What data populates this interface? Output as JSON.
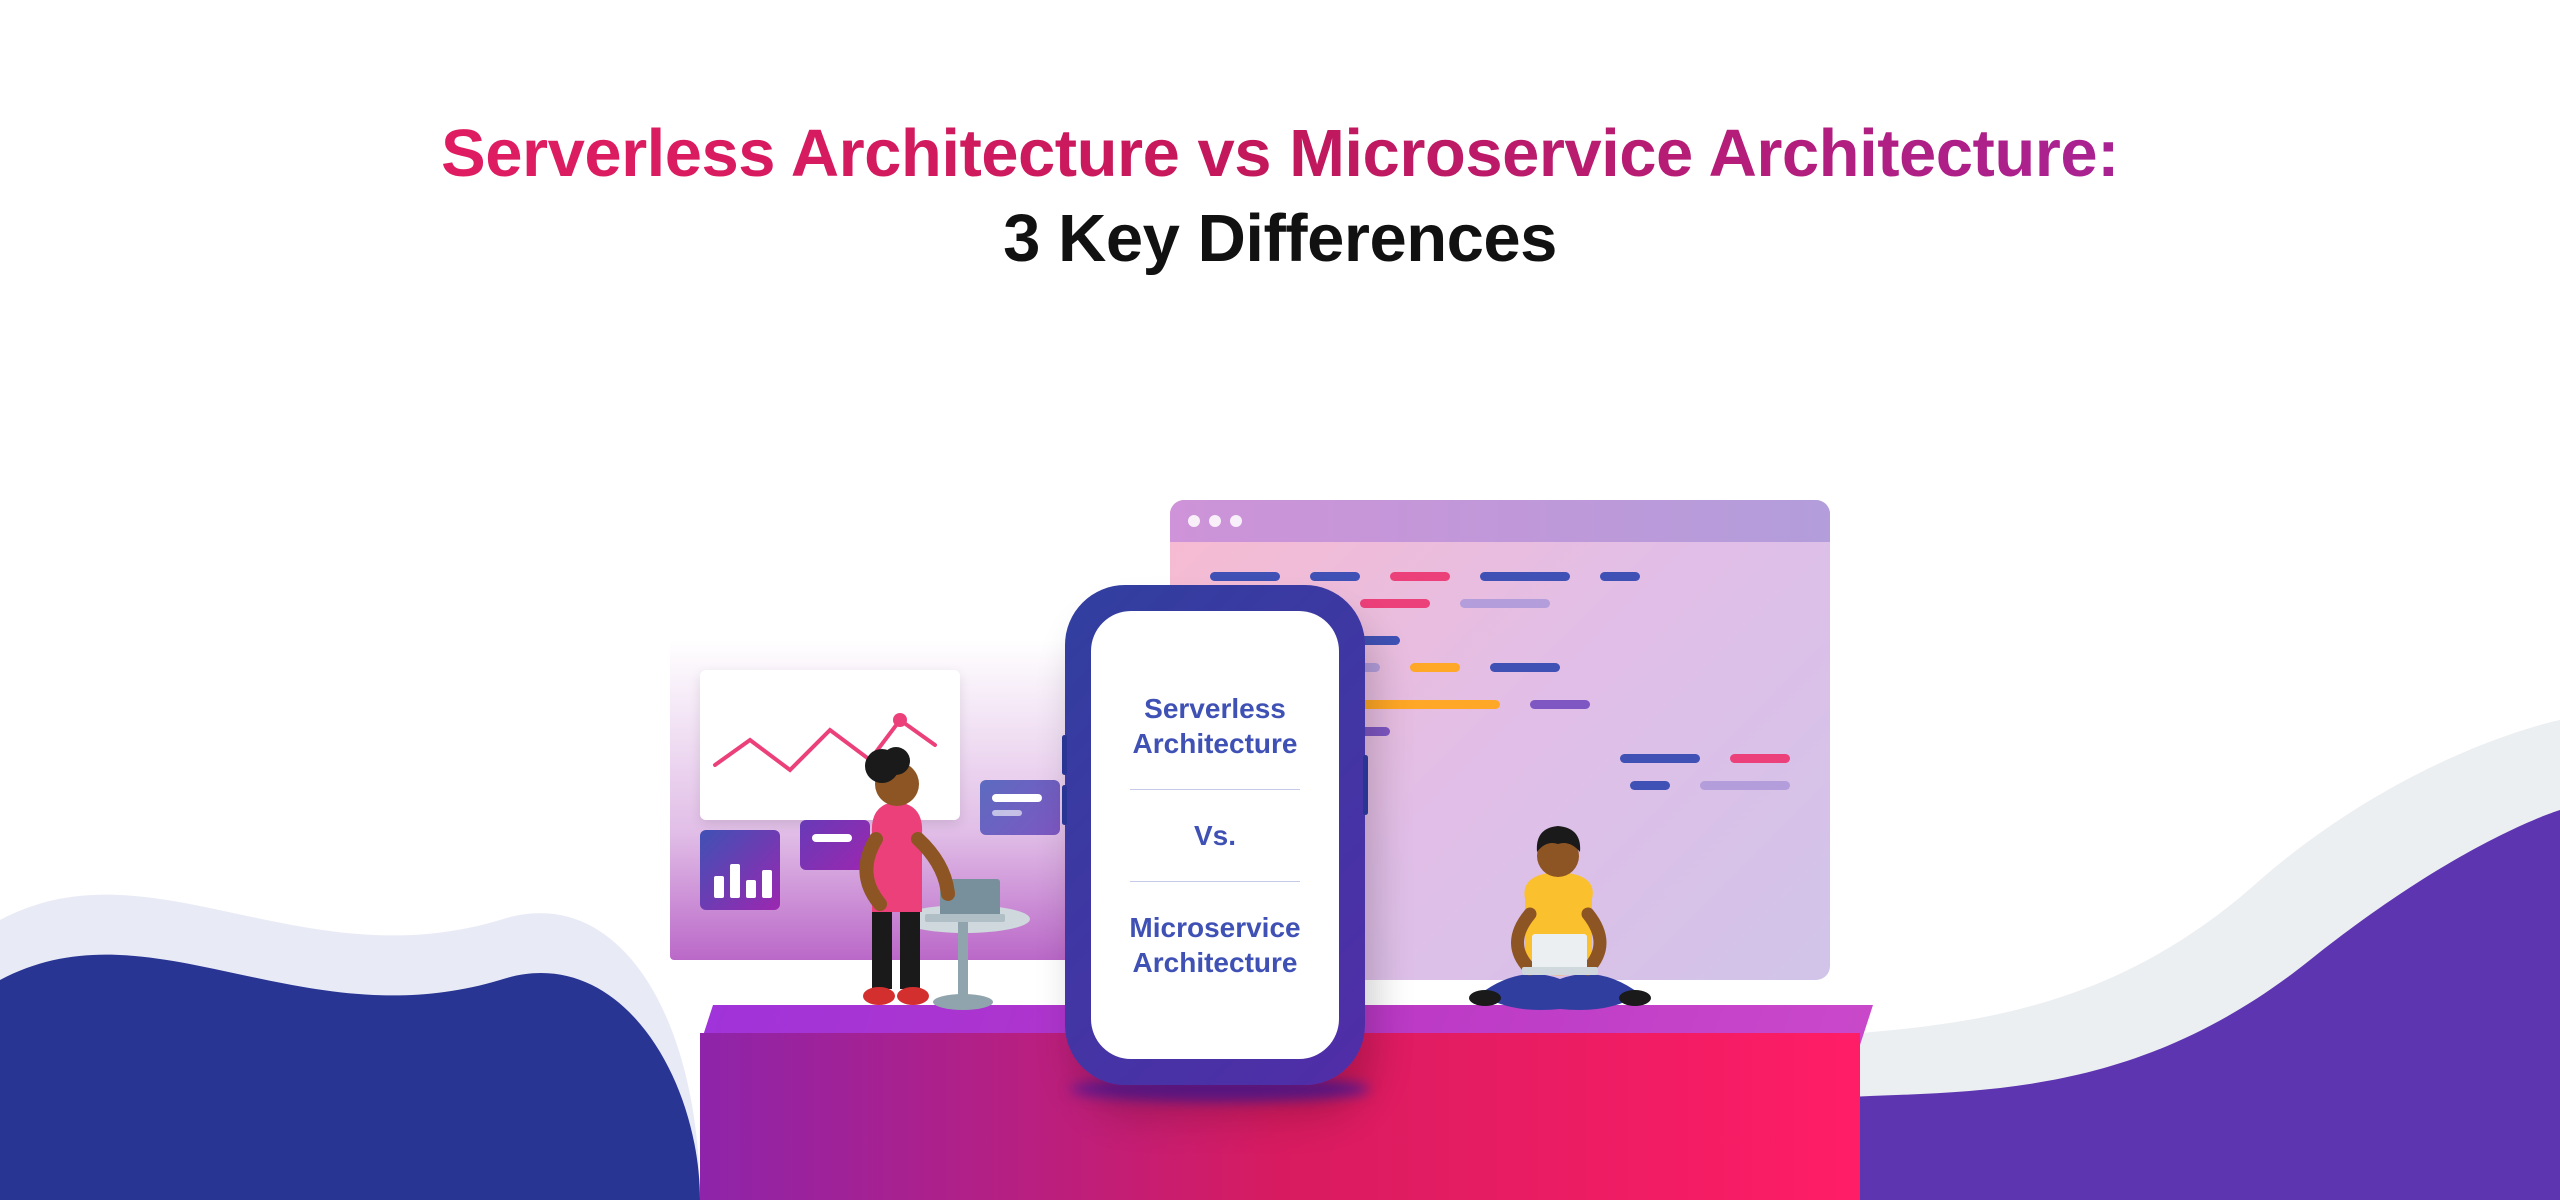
{
  "heading": {
    "line1": "Serverless Architecture vs Microservice Architecture:",
    "line2": "3 Key Differences"
  },
  "phone": {
    "top_line1": "Serverless",
    "top_line2": "Architecture",
    "middle": "Vs.",
    "bottom_line1": "Microservice",
    "bottom_line2": "Architecture"
  },
  "colors": {
    "gradient_start": "#e91e63",
    "gradient_end": "#9c27b0",
    "phone_text": "#3f51b5",
    "platform_from": "#8e24aa",
    "platform_to": "#ff1d66",
    "wave_navy": "#1a237e",
    "wave_purple": "#673ab7"
  }
}
